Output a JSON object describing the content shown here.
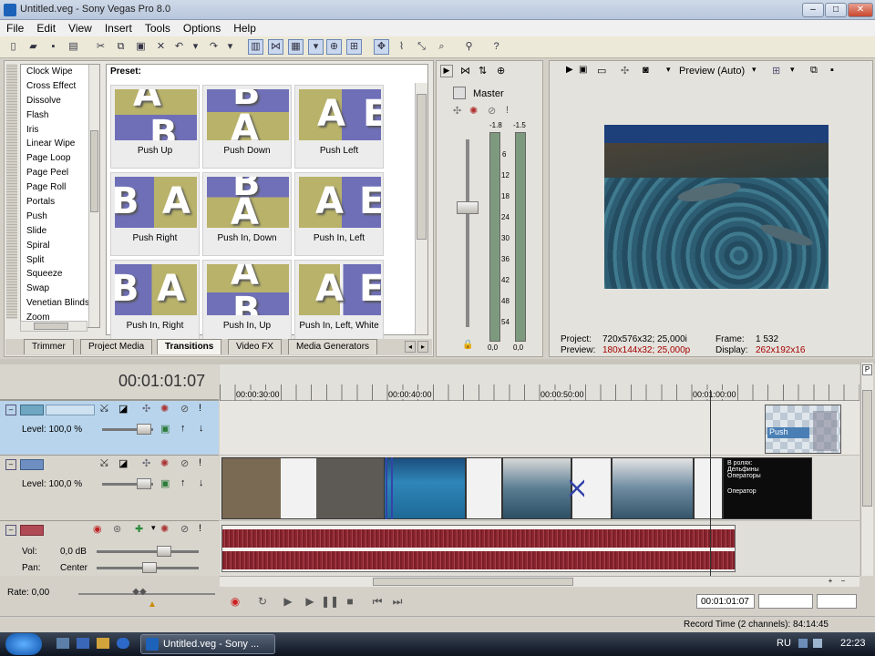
{
  "window": {
    "title": "Untitled.veg - Sony Vegas Pro 8.0",
    "min": "–",
    "max": "□",
    "close": "✕"
  },
  "menu": [
    "File",
    "Edit",
    "View",
    "Insert",
    "Tools",
    "Options",
    "Help"
  ],
  "transitions_list": [
    "Clock Wipe",
    "Cross Effect",
    "Dissolve",
    "Flash",
    "Iris",
    "Linear Wipe",
    "Page Loop",
    "Page Peel",
    "Page Roll",
    "Portals",
    "Push",
    "Slide",
    "Spiral",
    "Split",
    "Squeeze",
    "Swap",
    "Venetian Blinds",
    "Zoom"
  ],
  "preset": {
    "label": "Preset:",
    "items": [
      "Push Up",
      "Push Down",
      "Push Left",
      "Push Right",
      "Push In, Down",
      "Push In, Left",
      "Push In, Right",
      "Push In, Up",
      "Push In, Left, White"
    ]
  },
  "tabs": [
    "Trimmer",
    "Project Media",
    "Transitions",
    "Video FX",
    "Media Generators"
  ],
  "mixer": {
    "master": "Master",
    "peak_left": "-1.8",
    "peak_right": "-1.5",
    "scale": [
      "6",
      "12",
      "18",
      "24",
      "30",
      "36",
      "42",
      "48",
      "54"
    ],
    "bottom_left": "0,0",
    "bottom_right": "0,0"
  },
  "preview": {
    "mode": "Preview (Auto)",
    "project_label": "Project:",
    "project_value": "720x576x32; 25,000i",
    "preview_label": "Preview:",
    "preview_value": "180x144x32; 25,000p",
    "frame_label": "Frame:",
    "frame_value": "1 532",
    "display_label": "Display:",
    "display_value": "262x192x16"
  },
  "timeline": {
    "timecode": "00:01:01:07",
    "ruler": [
      "00:00:30:00",
      "00:00:40:00",
      "00:00:50:00",
      "00:01:00:00"
    ],
    "track1": {
      "level": "Level: 100,0 %"
    },
    "track2": {
      "level": "Level: 100,0 %"
    },
    "audio": {
      "vol_label": "Vol:",
      "vol_value": "0,0 dB",
      "pan_label": "Pan:",
      "pan_value": "Center"
    },
    "rate": "Rate: 0,00",
    "push_event": "Push",
    "title_text": [
      "В ролях:",
      "Дельфины",
      "Операторы",
      "Оператор"
    ]
  },
  "transport": {
    "timecode": "00:01:01:07"
  },
  "status": {
    "record_time": "Record Time (2 channels): 84:14:45"
  },
  "taskbar": {
    "task": "Untitled.veg - Sony ...",
    "lang": "RU",
    "clock": "22:23"
  },
  "colors": {
    "track_selected": "#b8d4ec",
    "audio_wave": "#8b2630",
    "accent_red": "#a30000"
  }
}
